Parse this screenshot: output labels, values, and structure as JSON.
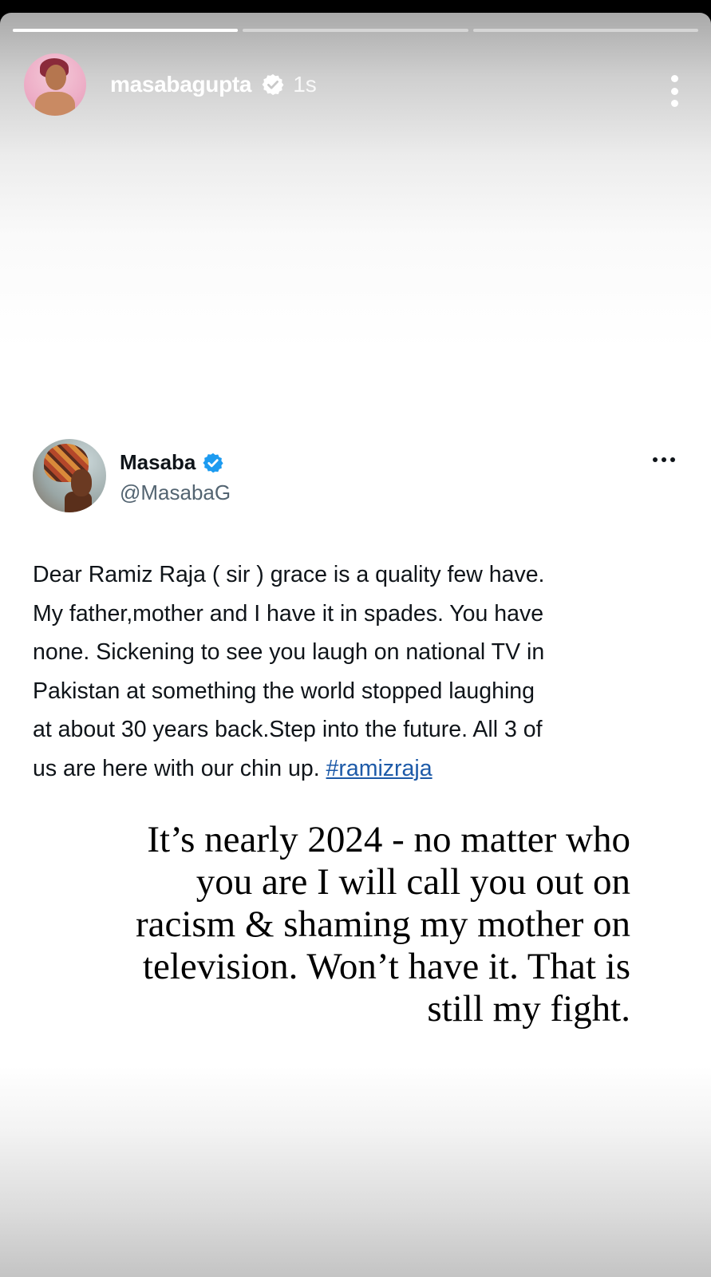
{
  "story": {
    "progress": [
      {
        "fill": 1.0
      },
      {
        "fill": 0.0
      },
      {
        "fill": 0.0
      }
    ],
    "username": "masabagupta",
    "verified_icon": "verified-badge-icon",
    "time": "1s",
    "more_icon": "more-vertical-icon"
  },
  "tweet": {
    "name": "Masaba",
    "verified_icon": "verified-badge-icon",
    "verified_color": "#1d9bf0",
    "handle": "@MasabaG",
    "more_icon": "more-horizontal-icon",
    "text_lines": [
      "Dear Ramiz Raja ( sir ) grace is a quality few have.",
      "My father,mother and I have it in spades. You have",
      "none. Sickening to see you laugh on national TV in",
      "Pakistan at something the world stopped laughing",
      "at about 30 years back.Step into the future. All 3 of",
      "us are here with our chin up. "
    ],
    "hashtag": "#ramizraja",
    "hashtag_color": "#1d5aa8"
  },
  "caption": {
    "lines": [
      "It’s nearly  2024  - no matter who",
      "you are I will call you out on",
      "racism & shaming my mother on",
      "television. Won’t have it. That is",
      "still my fight."
    ]
  }
}
